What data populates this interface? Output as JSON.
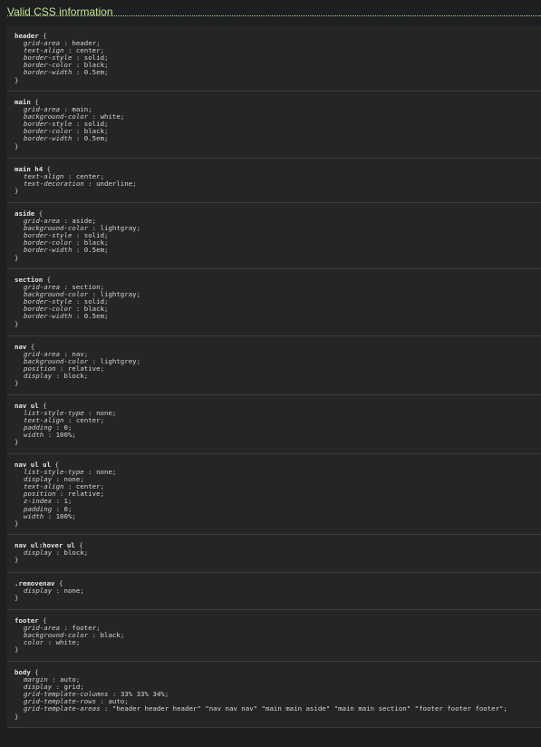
{
  "heading": "Valid CSS information",
  "rules": [
    {
      "selector": "header",
      "declarations": [
        {
          "property": "grid-area",
          "value": "header"
        },
        {
          "property": "text-align",
          "value": "center"
        },
        {
          "property": "border-style",
          "value": "solid"
        },
        {
          "property": "border-color",
          "value": "black"
        },
        {
          "property": "border-width",
          "value": "0.5em"
        }
      ]
    },
    {
      "selector": "main",
      "declarations": [
        {
          "property": "grid-area",
          "value": "main"
        },
        {
          "property": "background-color",
          "value": "white"
        },
        {
          "property": "border-style",
          "value": "solid"
        },
        {
          "property": "border-color",
          "value": "black"
        },
        {
          "property": "border-width",
          "value": "0.5em"
        }
      ]
    },
    {
      "selector": "main h4",
      "declarations": [
        {
          "property": "text-align",
          "value": "center"
        },
        {
          "property": "text-decoration",
          "value": "underline"
        }
      ]
    },
    {
      "selector": "aside",
      "declarations": [
        {
          "property": "grid-area",
          "value": "aside"
        },
        {
          "property": "background-color",
          "value": "lightgray"
        },
        {
          "property": "border-style",
          "value": "solid"
        },
        {
          "property": "border-color",
          "value": "black"
        },
        {
          "property": "border-width",
          "value": "0.5em"
        }
      ]
    },
    {
      "selector": "section",
      "declarations": [
        {
          "property": "grid-area",
          "value": "section"
        },
        {
          "property": "background-color",
          "value": "lightgray"
        },
        {
          "property": "border-style",
          "value": "solid"
        },
        {
          "property": "border-color",
          "value": "black"
        },
        {
          "property": "border-width",
          "value": "0.5em"
        }
      ]
    },
    {
      "selector": "nav",
      "declarations": [
        {
          "property": "grid-area",
          "value": "nav"
        },
        {
          "property": "background-color",
          "value": "lightgrey"
        },
        {
          "property": "position",
          "value": "relative"
        },
        {
          "property": "display",
          "value": "block"
        }
      ]
    },
    {
      "selector": "nav ul",
      "declarations": [
        {
          "property": "list-style-type",
          "value": "none"
        },
        {
          "property": "text-align",
          "value": "center"
        },
        {
          "property": "padding",
          "value": "0"
        },
        {
          "property": "width",
          "value": "100%"
        }
      ]
    },
    {
      "selector": "nav ul ul",
      "declarations": [
        {
          "property": "list-style-type",
          "value": "none"
        },
        {
          "property": "display",
          "value": "none"
        },
        {
          "property": "text-align",
          "value": "center"
        },
        {
          "property": "position",
          "value": "relative"
        },
        {
          "property": "z-index",
          "value": "1"
        },
        {
          "property": "padding",
          "value": "0"
        },
        {
          "property": "width",
          "value": "100%"
        }
      ]
    },
    {
      "selector": "nav ul:hover ul",
      "declarations": [
        {
          "property": "display",
          "value": "block"
        }
      ]
    },
    {
      "selector": ".removenav",
      "declarations": [
        {
          "property": "display",
          "value": "none"
        }
      ]
    },
    {
      "selector": "footer",
      "declarations": [
        {
          "property": "grid-area",
          "value": "footer"
        },
        {
          "property": "background-color",
          "value": "black"
        },
        {
          "property": "color",
          "value": "white"
        }
      ]
    },
    {
      "selector": "body",
      "declarations": [
        {
          "property": "margin",
          "value": "auto"
        },
        {
          "property": "display",
          "value": "grid"
        },
        {
          "property": "grid-template-columns",
          "value": "33% 33% 34%"
        },
        {
          "property": "grid-template-rows",
          "value": "auto"
        },
        {
          "property": "grid-template-areas",
          "value": "\"header header header\" \"nav nav nav\" \"main main aside\" \"main main section\" \"footer footer footer\""
        }
      ]
    }
  ]
}
